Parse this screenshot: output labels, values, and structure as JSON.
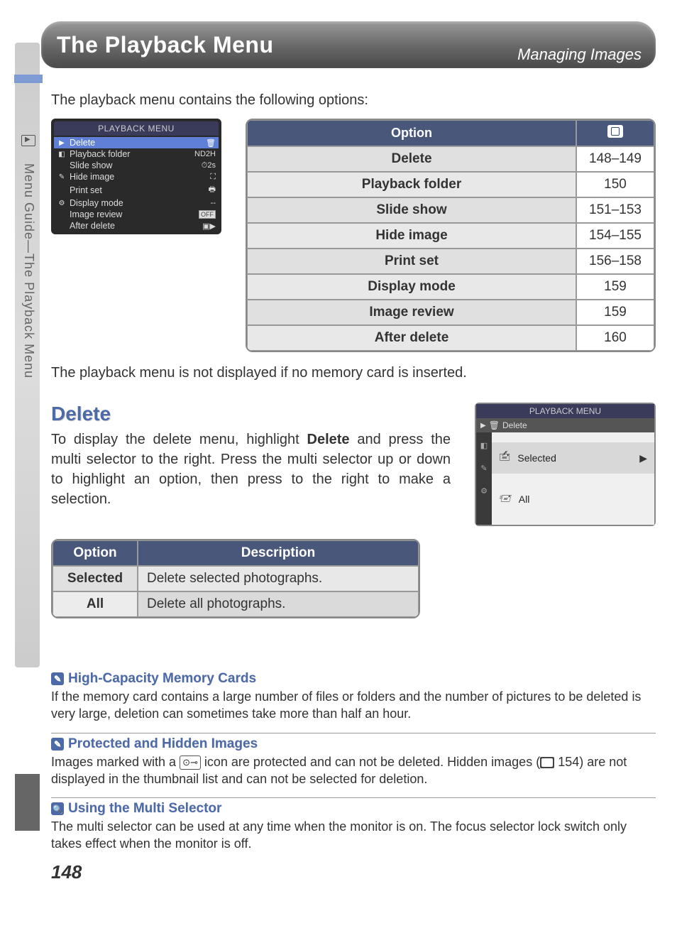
{
  "sidebar": {
    "label": "Menu Guide—The Playback Menu"
  },
  "header": {
    "title": "The Playback Menu",
    "subtitle": "Managing Images"
  },
  "intro": "The playback menu contains the following options:",
  "cam_menu1": {
    "title": "PLAYBACK MENU",
    "rows": [
      {
        "label": "Delete",
        "value": "",
        "icon": "🗑"
      },
      {
        "label": "Playback folder",
        "value": "ND2H"
      },
      {
        "label": "Slide show",
        "value": "⏱2s"
      },
      {
        "label": "Hide image",
        "value": "⛶"
      },
      {
        "label": "Print set",
        "value": "🖶"
      },
      {
        "label": "Display mode",
        "value": "--"
      },
      {
        "label": "Image review",
        "value": "OFF"
      },
      {
        "label": "After delete",
        "value": "▣▶"
      }
    ]
  },
  "options_table": {
    "head": {
      "col1": "Option",
      "col2_icon": "page-ref-icon"
    },
    "rows": [
      {
        "option": "Delete",
        "pages": "148–149"
      },
      {
        "option": "Playback folder",
        "pages": "150"
      },
      {
        "option": "Slide show",
        "pages": "151–153"
      },
      {
        "option": "Hide image",
        "pages": "154–155"
      },
      {
        "option": "Print set",
        "pages": "156–158"
      },
      {
        "option": "Display mode",
        "pages": "159"
      },
      {
        "option": "Image review",
        "pages": "159"
      },
      {
        "option": "After delete",
        "pages": "160"
      }
    ]
  },
  "intro2": "The playback menu is not displayed if no memory card is inserted.",
  "delete": {
    "heading": "Delete",
    "para_before_bold": "To display the delete menu, highlight ",
    "para_bold": "Delete",
    "para_after_bold": " and press the multi selector to the right.  Press the multi selector up or down to highlight an option, then press to the right to make a selection."
  },
  "cam_menu2": {
    "title": "PLAYBACK MENU",
    "sub": "Delete",
    "opt1": "Selected",
    "opt2": "All"
  },
  "del_table": {
    "head": {
      "col1": "Option",
      "col2": "Description"
    },
    "rows": [
      {
        "option": "Selected",
        "desc": "Delete selected photographs."
      },
      {
        "option": "All",
        "desc": "Delete all photographs."
      }
    ]
  },
  "notes": {
    "n1": {
      "title": "High-Capacity Memory Cards",
      "body": "If the memory card contains a large number of files or folders and the number of pictures to be deleted is very large, deletion can sometimes take more than half an hour."
    },
    "n2": {
      "title": "Protected and Hidden Images",
      "body_pre": "Images marked with a ",
      "body_mid": " icon are protected and can not be deleted.  Hidden images (",
      "body_page": " 154) are not displayed in the thumbnail list and can not be selected for deletion."
    },
    "n3": {
      "title": "Using the Multi Selector",
      "body": "The multi selector can be used at any time when the monitor is on.  The focus selector lock switch only takes effect when the monitor is off."
    }
  },
  "page_number": "148"
}
